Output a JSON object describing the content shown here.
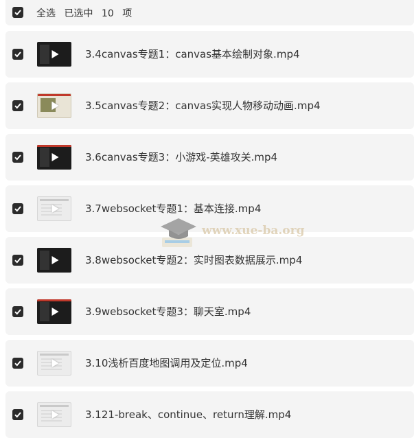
{
  "header": {
    "select_all_label": "全选",
    "selected_prefix": "已选中",
    "selected_count": "10",
    "selected_suffix": "项",
    "checked": true
  },
  "files": [
    {
      "title": "3.4canvas专题1：canvas基本绘制对象.mp4",
      "checked": true,
      "thumb": "dark"
    },
    {
      "title": "3.5canvas专题2：canvas实现人物移动动画.mp4",
      "checked": true,
      "thumb": "game"
    },
    {
      "title": "3.6canvas专题3：小游戏-英雄攻关.mp4",
      "checked": true,
      "thumb": "dark-red"
    },
    {
      "title": "3.7websocket专题1：基本连接.mp4",
      "checked": true,
      "thumb": "light"
    },
    {
      "title": "3.8websocket专题2：实时图表数据展示.mp4",
      "checked": true,
      "thumb": "dark"
    },
    {
      "title": "3.9websocket专题3：聊天室.mp4",
      "checked": true,
      "thumb": "dark-red"
    },
    {
      "title": "3.10浅析百度地图调用及定位.mp4",
      "checked": true,
      "thumb": "light"
    },
    {
      "title": "3.121-break、continue、return理解.mp4",
      "checked": true,
      "thumb": "light"
    }
  ],
  "watermark": {
    "text": "www.xue-ba.org"
  },
  "colors": {
    "row_bg": "#f4f4f4",
    "checkbox": "#2b2b2b",
    "text": "#333333"
  }
}
